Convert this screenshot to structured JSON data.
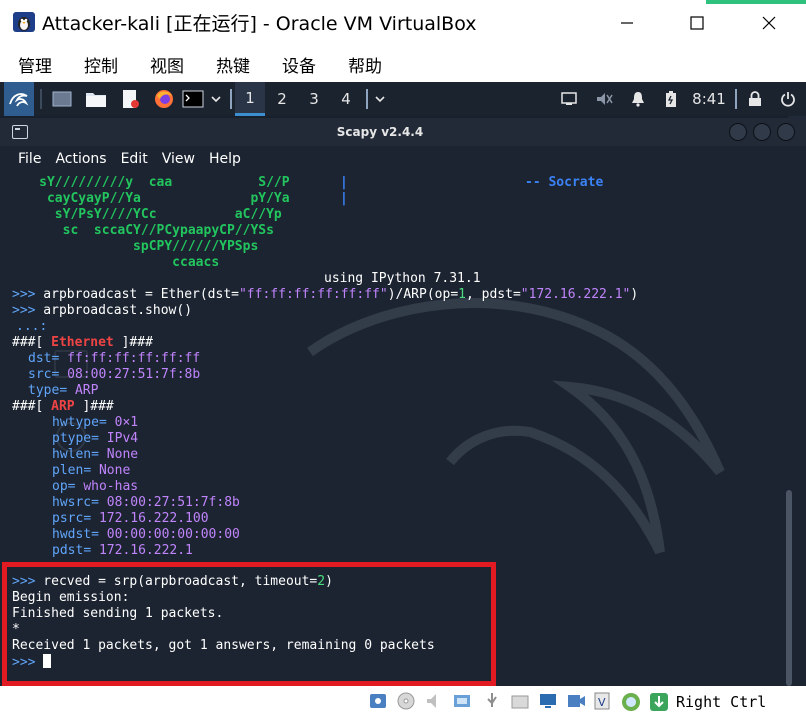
{
  "window": {
    "title": "Attacker-kali [正在运行] - Oracle VM VirtualBox"
  },
  "vbox_menu": [
    "管理",
    "控制",
    "视图",
    "热键",
    "设备",
    "帮助"
  ],
  "panel": {
    "workspaces": [
      "1",
      "2",
      "3",
      "4"
    ],
    "active_workspace": "1",
    "clock": "8:41"
  },
  "terminal": {
    "title": "Scapy v2.4.4",
    "menu": [
      "File",
      "Actions",
      "Edit",
      "View",
      "Help"
    ],
    "banner": {
      "art_lines": [
        "     sY/////////y  caa           S//P",
        "      cayCyayP//Ya              pY/Ya",
        "       sY/PsY////YCc          aC//Yp",
        "        sc  sccaCY//PCypaapyCP//YSs",
        "                 spCPY//////YPSps",
        "                      ccaacs"
      ],
      "pipe1": "|",
      "pipe2": "|",
      "quote_author": "-- Socrate",
      "ipython": "using IPython 7.31.1"
    },
    "prompt": ">>>",
    "cont_prompt": "...:",
    "cmd1": {
      "pre": " arpbroadcast = Ether(dst=",
      "dst_str": "\"ff:ff:ff:ff:ff:ff\"",
      "mid": ")/ARP(op=",
      "op_val": "1",
      "mid2": ", pdst=",
      "pdst_str": "\"172.16.222.1\"",
      "end": ")"
    },
    "cmd2": " arpbroadcast.show()",
    "eth_header": {
      "pre": "###[ ",
      "name": "Ethernet",
      "post": " ]###"
    },
    "eth_fields": [
      {
        "key": "dst",
        "val": "ff:ff:ff:ff:ff:ff"
      },
      {
        "key": "src",
        "val": "08:00:27:51:7f:8b"
      },
      {
        "key": "type",
        "val": "ARP"
      }
    ],
    "arp_header": {
      "pre": "###[ ",
      "name": "ARP",
      "post": " ]###"
    },
    "arp_fields": [
      {
        "key": "hwtype",
        "val": "0×1"
      },
      {
        "key": "ptype",
        "val": "IPv4"
      },
      {
        "key": "hwlen",
        "val": "None"
      },
      {
        "key": "plen",
        "val": "None"
      },
      {
        "key": "op",
        "val": "who-has"
      },
      {
        "key": "hwsrc",
        "val": "08:00:27:51:7f:8b"
      },
      {
        "key": "psrc",
        "val": "172.16.222.100"
      },
      {
        "key": "hwdst",
        "val": "00:00:00:00:00:00"
      },
      {
        "key": "pdst",
        "val": "172.16.222.1"
      }
    ],
    "cmd3": {
      "pre": " recved = srp(arpbroadcast, timeout=",
      "num": "2",
      "end": ")"
    },
    "output": [
      "Begin emission:",
      "Finished sending 1 packets.",
      "*",
      "Received 1 packets, got 1 answers, remaining 0 packets"
    ]
  },
  "statusbar": {
    "host_key": "Right Ctrl"
  },
  "colors": {
    "highlight_box": "#e21b23",
    "terminal_bg": "#1c2431",
    "panel_bg": "#1b232f"
  }
}
